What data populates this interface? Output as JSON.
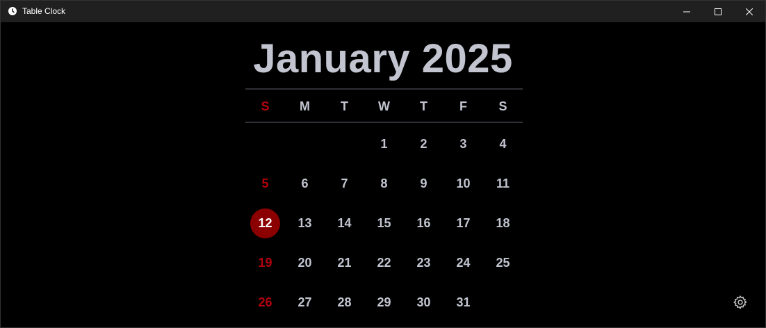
{
  "window": {
    "title": "Table Clock"
  },
  "calendar": {
    "title": "January 2025",
    "weekdays": [
      "S",
      "M",
      "T",
      "W",
      "T",
      "F",
      "S"
    ],
    "first_weekday_index": 3,
    "days_in_month": 31,
    "today": 12,
    "colors": {
      "text": "#c2c5d0",
      "sunday": "#b3000c",
      "today_bg": "#8b0000"
    }
  }
}
